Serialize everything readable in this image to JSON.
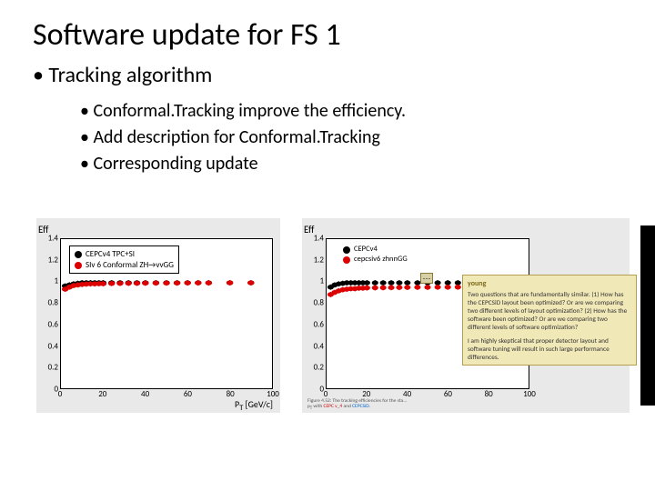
{
  "title": "Software update for FS 1",
  "bullet1": "Tracking algorithm",
  "bullets2": [
    "Conformal.Tracking improve the efficiency.",
    "Add description for Conformal.Tracking",
    "Corresponding update"
  ],
  "chart_data": [
    {
      "type": "scatter",
      "ylabel": "Eff",
      "xlabel": "P_T [GeV/c]",
      "ylim": [
        0,
        1.4
      ],
      "xlim": [
        0,
        100
      ],
      "yticks": [
        0,
        0.2,
        0.4,
        0.6,
        0.8,
        1,
        1.2,
        1.4
      ],
      "xticks": [
        0,
        20,
        40,
        60,
        80,
        100
      ],
      "legend": [
        {
          "name": "CEPCv4 TPC+SI",
          "color": "#000"
        },
        {
          "name": "SIv 6 Conformal ZH→vvGG",
          "color": "#d00"
        }
      ],
      "series": [
        {
          "name": "CEPCv4 TPC+SI",
          "color": "#000",
          "x": [
            2,
            4,
            6,
            8,
            10,
            12,
            14,
            16,
            18,
            20,
            24,
            28,
            32,
            36,
            40,
            45,
            50,
            55,
            60,
            65,
            70,
            80,
            90
          ],
          "y": [
            0.96,
            0.97,
            0.98,
            0.985,
            0.99,
            0.99,
            0.99,
            0.99,
            0.99,
            0.99,
            0.99,
            0.99,
            0.99,
            0.99,
            0.99,
            0.99,
            0.99,
            0.99,
            0.99,
            0.99,
            0.99,
            0.99,
            0.99
          ]
        },
        {
          "name": "SIv 6 Conformal",
          "color": "#d00",
          "x": [
            2,
            4,
            6,
            8,
            10,
            12,
            14,
            16,
            18,
            20,
            24,
            28,
            32,
            36,
            40,
            45,
            50,
            55,
            60,
            65,
            70,
            80,
            90
          ],
          "y": [
            0.93,
            0.95,
            0.965,
            0.97,
            0.975,
            0.978,
            0.98,
            0.98,
            0.982,
            0.982,
            0.984,
            0.985,
            0.986,
            0.986,
            0.987,
            0.988,
            0.988,
            0.988,
            0.989,
            0.989,
            0.989,
            0.99,
            0.99
          ]
        }
      ]
    },
    {
      "type": "scatter",
      "ylabel": "Eff",
      "xlabel": "",
      "ylim": [
        0,
        1.4
      ],
      "xlim": [
        0,
        100
      ],
      "yticks": [
        0,
        0.2,
        0.4,
        0.6,
        0.8,
        1,
        1.2,
        1.4
      ],
      "xticks": [
        0,
        20,
        40,
        60,
        80,
        100
      ],
      "legend": [
        {
          "name": "CEPCv4",
          "color": "#000"
        },
        {
          "name": "cepcsiv6 zhnnGG",
          "color": "#d00"
        }
      ],
      "series": [
        {
          "name": "CEPCv4",
          "color": "#000",
          "x": [
            2,
            4,
            6,
            8,
            10,
            12,
            14,
            16,
            18,
            20,
            24,
            28,
            32,
            36,
            40,
            45,
            50,
            55,
            60,
            65,
            70,
            80,
            90
          ],
          "y": [
            0.95,
            0.97,
            0.98,
            0.985,
            0.99,
            0.99,
            0.99,
            0.99,
            0.99,
            0.99,
            0.99,
            0.99,
            0.99,
            0.99,
            0.99,
            0.99,
            0.99,
            0.99,
            0.99,
            0.99,
            0.99,
            0.99,
            0.99
          ]
        },
        {
          "name": "cepcsiv6",
          "color": "#d00",
          "x": [
            2,
            4,
            6,
            8,
            10,
            12,
            14,
            16,
            18,
            20,
            24,
            28,
            32,
            36,
            40,
            45,
            50,
            55,
            60,
            65,
            70,
            80,
            90
          ],
          "y": [
            0.88,
            0.9,
            0.915,
            0.925,
            0.93,
            0.935,
            0.935,
            0.94,
            0.94,
            0.942,
            0.943,
            0.944,
            0.945,
            0.946,
            0.947,
            0.948,
            0.948,
            0.949,
            0.949,
            0.95,
            0.95,
            0.95,
            0.95
          ]
        }
      ],
      "caption": "Figure 4.52: The tracking efficiencies for the ... p_T with CEPC v_4 and CEPCSiD."
    }
  ],
  "comment": {
    "author": "young",
    "body1": "Two questions that are fundamentally similar. (1) How has the CEPCSiD layout been optimized? Or are we comparing two different levels of layout optimization? (2) How has the software been optimized? Or are we comparing two different levels of software optimization?",
    "body2": "I am highly skeptical that proper detector layout and software tuning will result in such large performance differences."
  },
  "comment_pin": "⋯"
}
